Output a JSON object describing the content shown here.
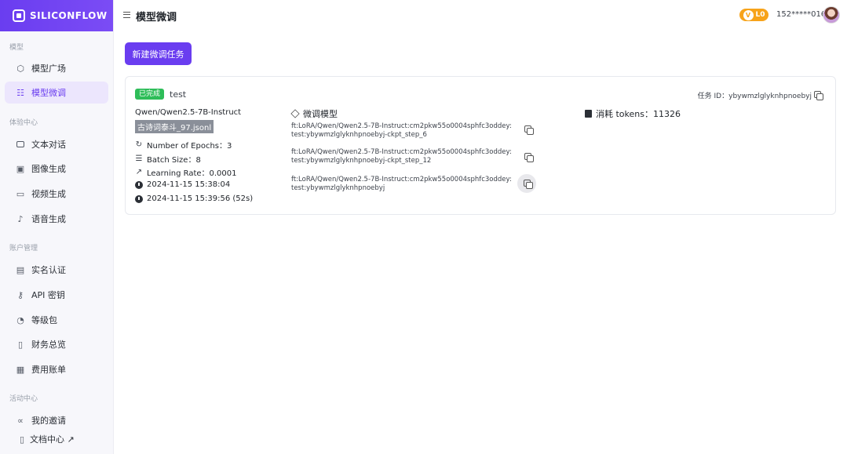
{
  "brand": {
    "name": "SILICONFLOW"
  },
  "sidebar": {
    "groups": [
      {
        "label": "模型"
      },
      {
        "label": "体验中心"
      },
      {
        "label": "账户管理"
      },
      {
        "label": "活动中心"
      }
    ],
    "items": [
      {
        "label": "模型广场",
        "icon": "cube-icon"
      },
      {
        "label": "模型微调",
        "icon": "tune-icon",
        "active": true
      },
      {
        "label": "文本对话",
        "icon": "chat-icon"
      },
      {
        "label": "图像生成",
        "icon": "image-icon"
      },
      {
        "label": "视频生成",
        "icon": "video-icon"
      },
      {
        "label": "语音生成",
        "icon": "microphone-icon"
      },
      {
        "label": "实名认证",
        "icon": "id-card-icon"
      },
      {
        "label": "API 密钥",
        "icon": "key-icon"
      },
      {
        "label": "等级包",
        "icon": "gauge-icon"
      },
      {
        "label": "财务总览",
        "icon": "wallet-icon"
      },
      {
        "label": "费用账单",
        "icon": "bill-icon"
      },
      {
        "label": "我的邀请",
        "icon": "share-icon"
      }
    ],
    "doc_link": "文档中心 ↗"
  },
  "header": {
    "title": "模型微调",
    "level": "L0",
    "phone": "152*****016"
  },
  "main": {
    "new_task_label": "新建微调任务"
  },
  "task": {
    "status": "已完成",
    "name": "test",
    "id_text": "任务 ID：ybywmzlglyknhpnoebyj",
    "base_model": "Qwen/Qwen2.5-7B-Instruct",
    "dataset": "古诗词泰斗_97.jsonl",
    "epochs": "Number of Epochs：3",
    "batch": "Batch Size：8",
    "lr": "Learning Rate：0.0001",
    "created": "2024-11-15 15:38:04",
    "finished": "2024-11-15 15:39:56 (52s)",
    "models_heading": "微调模型",
    "checkpoints": [
      {
        "line1": "ft:LoRA/Qwen/Qwen2.5-7B-Instruct:cm2pkw55o0004sphfc3oddey:",
        "line2": "test:ybywmzlglyknhpnoebyj-ckpt_step_6"
      },
      {
        "line1": "ft:LoRA/Qwen/Qwen2.5-7B-Instruct:cm2pkw55o0004sphfc3oddey:",
        "line2": "test:ybywmzlglyknhpnoebyj-ckpt_step_12"
      },
      {
        "line1": "ft:LoRA/Qwen/Qwen2.5-7B-Instruct:cm2pkw55o0004sphfc3oddey:",
        "line2": "test:ybywmzlglyknhpnoebyj"
      }
    ],
    "tokens": "消耗 tokens：11326"
  },
  "colors": {
    "accent": "#6a3df0",
    "success": "#2ebd59",
    "level": "#f7a31a"
  }
}
